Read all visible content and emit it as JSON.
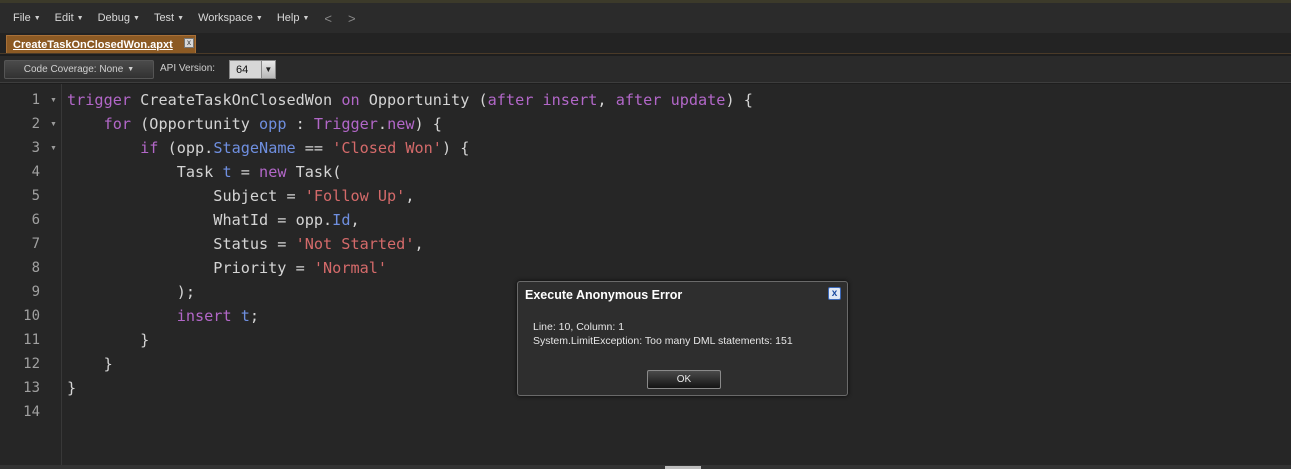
{
  "menu": {
    "items": [
      {
        "label": "File"
      },
      {
        "label": "Edit"
      },
      {
        "label": "Debug"
      },
      {
        "label": "Test"
      },
      {
        "label": "Workspace"
      },
      {
        "label": "Help"
      }
    ],
    "back_icon": "<",
    "forward_icon": ">"
  },
  "tab": {
    "label": "CreateTaskOnClosedWon.apxt",
    "close_icon": "x"
  },
  "toolbar": {
    "coverage_label": "Code Coverage: None",
    "api_label": "API Version:",
    "api_value": "64"
  },
  "editor": {
    "line_numbers": [
      "1",
      "2",
      "3",
      "4",
      "5",
      "6",
      "7",
      "8",
      "9",
      "10",
      "11",
      "12",
      "13",
      "14"
    ],
    "fold_lines": [
      1,
      2,
      3
    ],
    "code": [
      [
        {
          "t": "trigger",
          "c": "kw"
        },
        {
          "t": " CreateTaskOnClosedWon "
        },
        {
          "t": "on",
          "c": "kw"
        },
        {
          "t": " Opportunity ("
        },
        {
          "t": "after",
          "c": "kw"
        },
        {
          "t": " "
        },
        {
          "t": "insert",
          "c": "kw"
        },
        {
          "t": ", "
        },
        {
          "t": "after",
          "c": "kw"
        },
        {
          "t": " "
        },
        {
          "t": "update",
          "c": "kw"
        },
        {
          "t": ") {"
        }
      ],
      [
        {
          "t": "    "
        },
        {
          "t": "for",
          "c": "kw"
        },
        {
          "t": " (Opportunity "
        },
        {
          "t": "opp",
          "c": "fld"
        },
        {
          "t": " : "
        },
        {
          "t": "Trigger",
          "c": "kw"
        },
        {
          "t": "."
        },
        {
          "t": "new",
          "c": "kw"
        },
        {
          "t": ") {"
        }
      ],
      [
        {
          "t": "        "
        },
        {
          "t": "if",
          "c": "kw"
        },
        {
          "t": " (opp."
        },
        {
          "t": "StageName",
          "c": "fld"
        },
        {
          "t": " == "
        },
        {
          "t": "'Closed Won'",
          "c": "str"
        },
        {
          "t": ") {"
        }
      ],
      [
        {
          "t": "            Task "
        },
        {
          "t": "t",
          "c": "fld"
        },
        {
          "t": " = "
        },
        {
          "t": "new",
          "c": "kw"
        },
        {
          "t": " Task("
        }
      ],
      [
        {
          "t": "                Subject = "
        },
        {
          "t": "'Follow Up'",
          "c": "str"
        },
        {
          "t": ","
        }
      ],
      [
        {
          "t": "                WhatId = opp."
        },
        {
          "t": "Id",
          "c": "fld"
        },
        {
          "t": ","
        }
      ],
      [
        {
          "t": "                Status = "
        },
        {
          "t": "'Not Started'",
          "c": "str"
        },
        {
          "t": ","
        }
      ],
      [
        {
          "t": "                Priority = "
        },
        {
          "t": "'Normal'",
          "c": "str"
        }
      ],
      [
        {
          "t": "            );"
        }
      ],
      [
        {
          "t": "            "
        },
        {
          "t": "insert",
          "c": "kw"
        },
        {
          "t": " "
        },
        {
          "t": "t",
          "c": "fld"
        },
        {
          "t": ";"
        }
      ],
      [
        {
          "t": "        }"
        }
      ],
      [
        {
          "t": "    }"
        }
      ],
      [
        {
          "t": "}"
        }
      ],
      [
        {
          "t": ""
        }
      ]
    ]
  },
  "dialog": {
    "title": "Execute Anonymous Error",
    "close_icon": "x",
    "line1": "Line: 10, Column: 1",
    "line2": "System.LimitException: Too many DML statements: 151",
    "ok_label": "OK"
  },
  "colors": {
    "keyword": "#b267c8",
    "field": "#6f8fe0",
    "string": "#d46a6a",
    "tab_accent": "#8c5a24"
  }
}
